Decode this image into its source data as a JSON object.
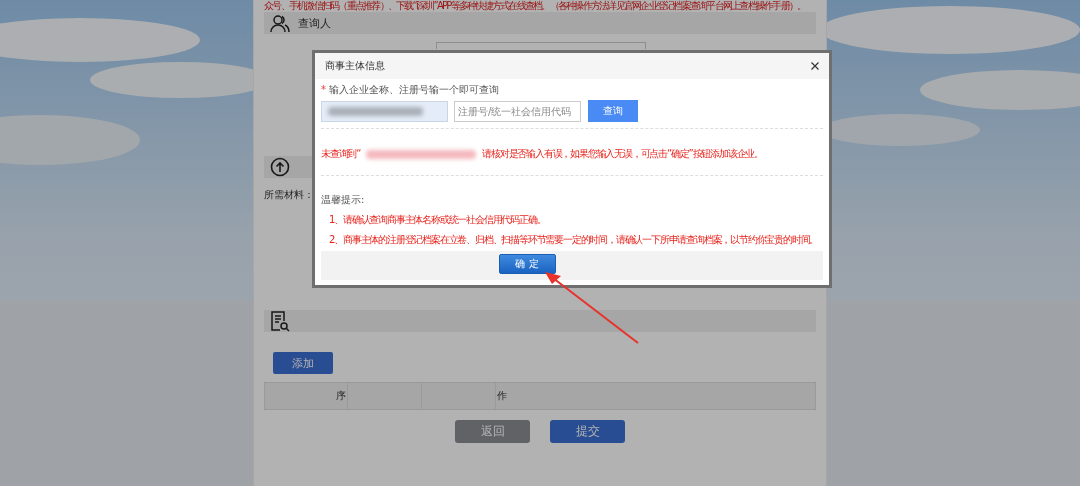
{
  "page": {
    "notice": "众号、手机微信扫码（重点推荐）、下载“i深圳”APP等多种快捷方式在线查档。（各种操作方法详见官网企业登记档案查询平台网上查档操作手册）。",
    "section_title": "查询人",
    "materials_label": "所需材料：",
    "add_button": "添加",
    "table_columns": [
      "序",
      "作"
    ],
    "buttons": [
      {
        "label": "返回",
        "kind": "secondary"
      },
      {
        "label": "提交",
        "kind": "primary"
      }
    ]
  },
  "modal": {
    "title": "商事主体信息",
    "field_label": {
      "required_mark": "*",
      "text": "输入企业全称、注册号输一个即可查询"
    },
    "fields": [
      {
        "kind": "blurred"
      },
      {
        "kind": "text",
        "placeholder": "注册号/统一社会信用代码"
      }
    ],
    "search_button": "查询",
    "message": {
      "before": "未查询到“",
      "after": "请核对是否输入有误，如果您输入无误，可点击“确定”按钮添加该企业。"
    },
    "tips_title": "温馨提示:",
    "tips": [
      "1、请确认查询商事主体名称或统一社会信用代码正确。",
      "2、商事主体的注册登记档案在立卷、归档、扫描等环节需要一定的时间，请确认一下所申请查询档案，以节约你宝贵的时间。"
    ],
    "confirm_button": "确 定"
  }
}
